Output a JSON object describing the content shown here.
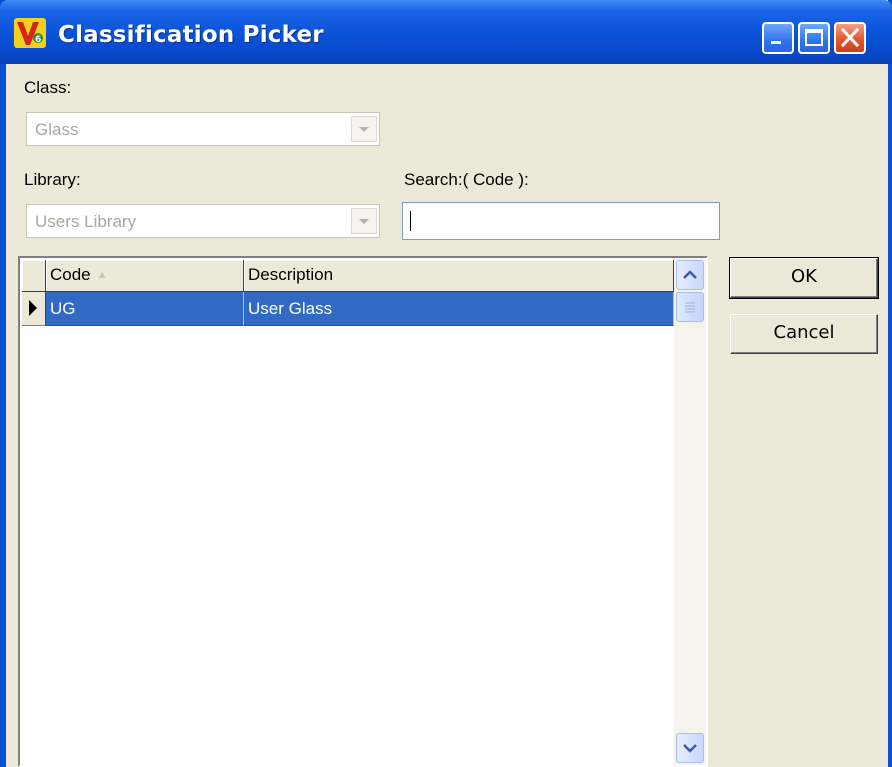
{
  "window": {
    "title": "Classification Picker",
    "app_icon": "v6-logo-icon"
  },
  "class_field": {
    "label": "Class:",
    "value": "Glass"
  },
  "library_field": {
    "label": "Library:",
    "value": "Users Library"
  },
  "search_field": {
    "label": "Search:( Code ):",
    "value": ""
  },
  "grid": {
    "columns": [
      "Code",
      "Description"
    ],
    "sorted_column": "Code",
    "sort_direction": "ascending",
    "rows": [
      {
        "code": "UG",
        "description": "User Glass",
        "selected": true
      }
    ]
  },
  "buttons": {
    "ok": "OK",
    "cancel": "Cancel"
  },
  "colors": {
    "titlebar": "#0a52d8",
    "selection": "#316ac5",
    "face": "#ece9d8"
  }
}
